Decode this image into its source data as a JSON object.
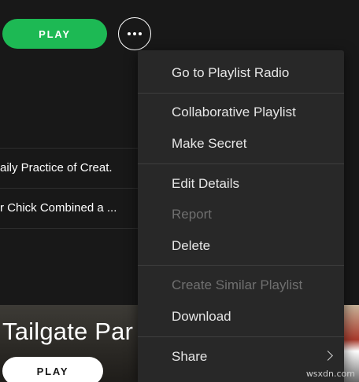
{
  "header": {
    "play_label": "PLAY",
    "more_icon": "ellipsis-icon"
  },
  "tracks": [
    {
      "title": "aily Practice of Creat."
    },
    {
      "title": "r Chick Combined a ..."
    }
  ],
  "card": {
    "title": "Tailgate Par",
    "play_label": "PLAY"
  },
  "menu": {
    "items": [
      {
        "label": "Go to Playlist Radio",
        "enabled": true
      },
      {
        "label": "Collaborative Playlist",
        "enabled": true
      },
      {
        "label": "Make Secret",
        "enabled": true
      },
      {
        "label": "Edit Details",
        "enabled": true
      },
      {
        "label": "Report",
        "enabled": false
      },
      {
        "label": "Delete",
        "enabled": true
      },
      {
        "label": "Create Similar Playlist",
        "enabled": false
      },
      {
        "label": "Download",
        "enabled": true
      },
      {
        "label": "Share",
        "enabled": true,
        "submenu_icon": "chevron-right-icon"
      }
    ]
  },
  "watermark": "wsxdn.com",
  "colors": {
    "background": "#181818",
    "accent": "#1db954",
    "menu_bg": "#282828",
    "text": "#ffffff",
    "disabled_text": "#6f6f6f"
  }
}
